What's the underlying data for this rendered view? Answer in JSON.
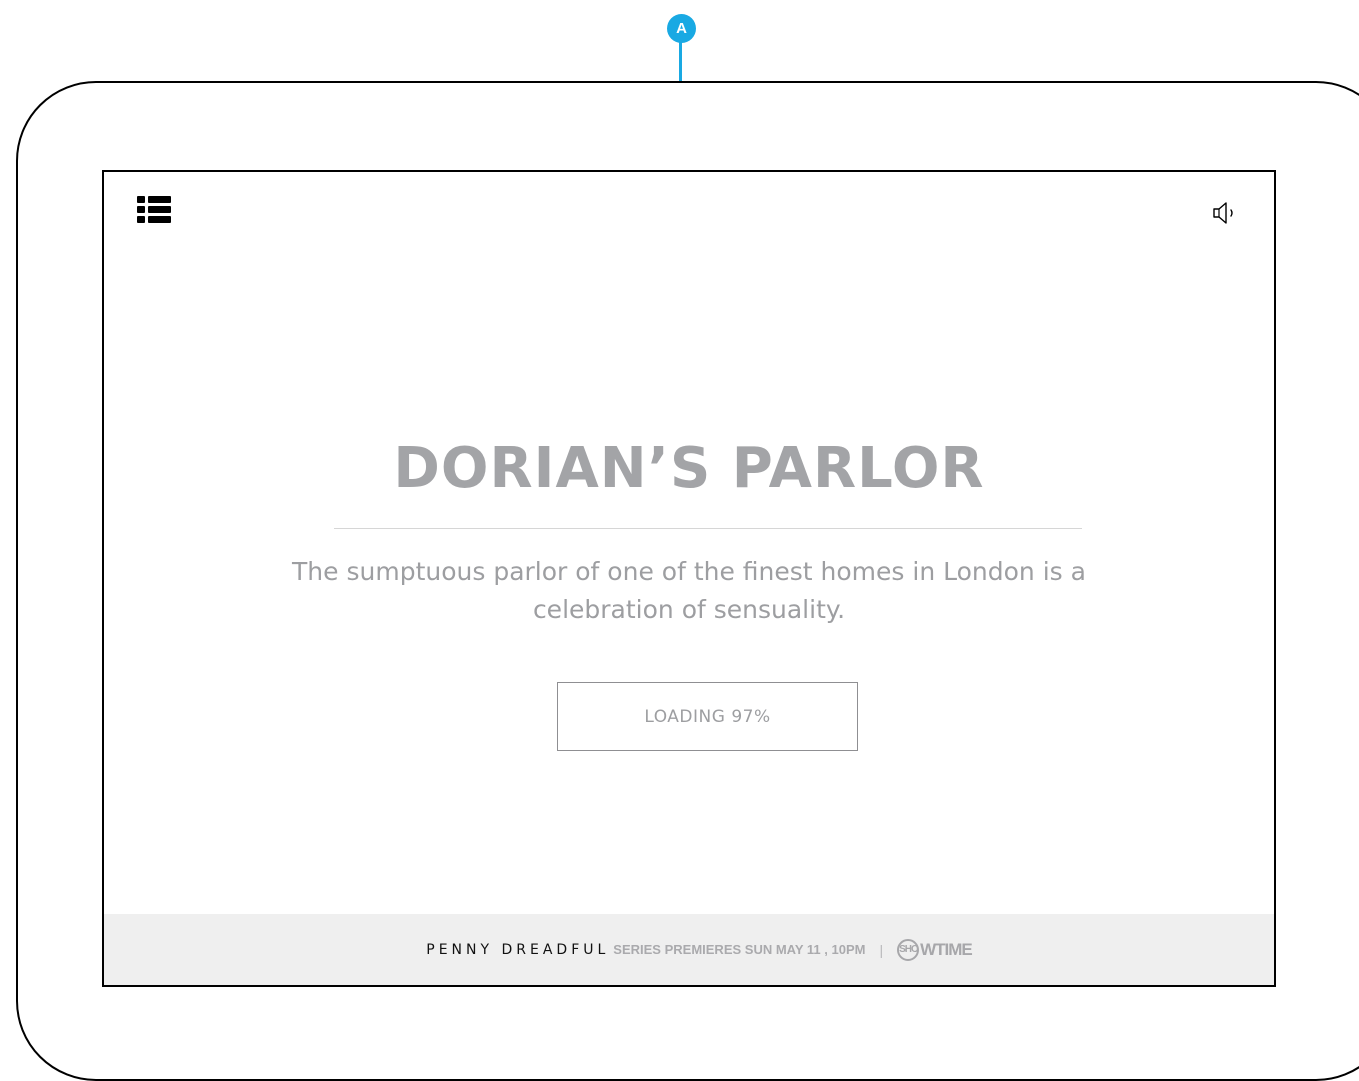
{
  "annotation": {
    "label": "A",
    "color": "#19a9e3"
  },
  "toolbar": {
    "menu_icon": "list-icon",
    "sound_icon": "speaker-icon"
  },
  "location": {
    "title": "DORIAN’S PARLOR",
    "description": "The sumptuous parlor of one of the finest homes in London is a celebration of sensuality."
  },
  "loading": {
    "label": "LOADING 97%",
    "progress_percent": 97
  },
  "footer": {
    "show_title": "PENNY DREADFUL",
    "premiere_text": "SERIES PREMIERES SUN MAY 11 , 10PM",
    "separator": "|",
    "network_badge": "SHO",
    "network_rest": "WTIME"
  },
  "colors": {
    "title": "#a3a4a7",
    "body_text": "#9d9ea1",
    "footer_bg": "#efefef",
    "accent": "#19a9e3"
  }
}
